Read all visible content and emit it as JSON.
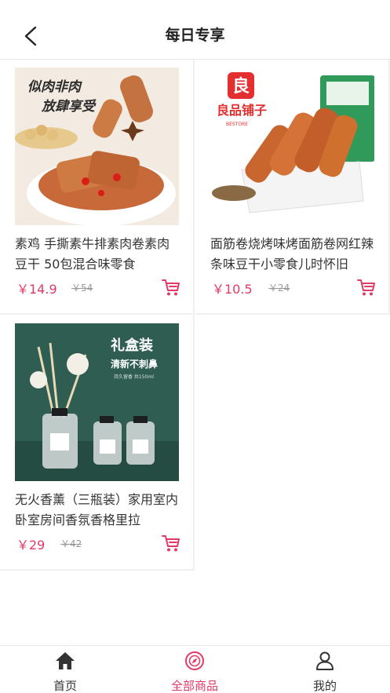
{
  "header": {
    "title": "每日专享"
  },
  "products": [
    {
      "title": "素鸡 手撕素牛排素肉卷素肉豆干 50包混合味零食",
      "price": "￥14.9",
      "old_price": "￥54",
      "image_text": [
        "似肉非肉",
        "放肆享受"
      ]
    },
    {
      "title": "面筋卷烧烤味烤面筋卷网红辣条味豆干小零食儿时怀旧",
      "price": "￥10.5",
      "old_price": "￥24",
      "image_text": [
        "良品铺子",
        "BESTORE",
        "良"
      ]
    },
    {
      "title": "无火香薰（三瓶装）家用室内卧室房间香氛香格里拉",
      "price": "￥29",
      "old_price": "￥42",
      "image_text": [
        "礼盒装",
        "清新不刺鼻",
        "持久留香 共150ml"
      ]
    }
  ],
  "tabbar": {
    "items": [
      {
        "label": "首页",
        "icon": "home-icon"
      },
      {
        "label": "全部商品",
        "icon": "compass-icon"
      },
      {
        "label": "我的",
        "icon": "user-icon"
      }
    ],
    "active": "全部商品"
  },
  "colors": {
    "accent": "#e03a66",
    "text": "#333333",
    "muted": "#9a9a9a",
    "divider": "#f0f0f0"
  }
}
